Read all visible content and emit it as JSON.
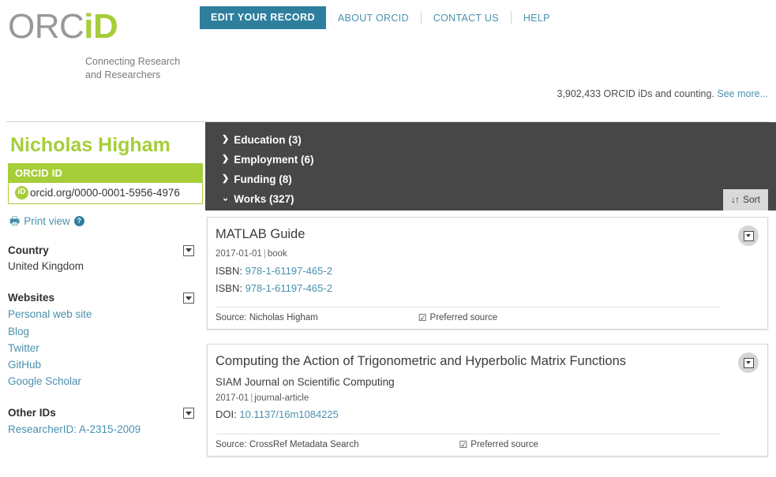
{
  "header": {
    "logo": {
      "part1": "ORC",
      "part2": "iD"
    },
    "tagline_line1": "Connecting Research",
    "tagline_line2": "and Researchers",
    "nav": {
      "primary_label": "EDIT YOUR RECORD",
      "links": [
        "ABOUT ORCID",
        "CONTACT US",
        "HELP"
      ]
    },
    "counter_text": "3,902,433 ORCID iDs and counting.",
    "counter_link": "See more..."
  },
  "sidebar": {
    "person_name": "Nicholas Higham",
    "orcid_box_title": "ORCID ID",
    "orcid_id_prefix": "iD",
    "orcid_id": "orcid.org/0000-0001-5956-4976",
    "print_view_label": "Print view",
    "sections": [
      {
        "title": "Country",
        "values": [
          "United Kingdom"
        ],
        "links": []
      },
      {
        "title": "Websites",
        "values": [],
        "links": [
          "Personal web site",
          "Blog",
          "Twitter",
          "GitHub",
          "Google Scholar"
        ]
      },
      {
        "title": "Other IDs",
        "values": [],
        "links": [
          "ResearcherID: A-2315-2009"
        ]
      }
    ]
  },
  "main": {
    "accordion": [
      {
        "label": "Education (3)",
        "expanded": false,
        "arrow": "❯"
      },
      {
        "label": "Employment (6)",
        "expanded": false,
        "arrow": "❯"
      },
      {
        "label": "Funding (8)",
        "expanded": false,
        "arrow": "❯"
      },
      {
        "label": "Works (327)",
        "expanded": true,
        "arrow": "⌄"
      }
    ],
    "sort_label": "Sort",
    "sort_glyph": "↓↑",
    "works": [
      {
        "title": "MATLAB Guide",
        "journal": "",
        "date": "2017-01-01",
        "type": "book",
        "identifiers": [
          {
            "label": "ISBN:",
            "value": "978-1-61197-465-2"
          },
          {
            "label": "ISBN:",
            "value": "978-1-61197-465-2"
          }
        ],
        "source_label": "Source: Nicholas Higham",
        "preferred_label": "Preferred source"
      },
      {
        "title": "Computing the Action of Trigonometric and Hyperbolic Matrix Functions",
        "journal": "SIAM Journal on Scientific Computing",
        "date": "2017-01",
        "type": "journal-article",
        "identifiers": [
          {
            "label": "DOI:",
            "value": "10.1137/16m1084225"
          }
        ],
        "source_label": "Source: CrossRef Metadata Search",
        "preferred_label": "Preferred source"
      }
    ]
  },
  "colors": {
    "orcid_green": "#a6ce39",
    "orcid_blue": "#2e7f9e",
    "link_blue": "#4a91ae",
    "panel_dark": "#474747"
  }
}
